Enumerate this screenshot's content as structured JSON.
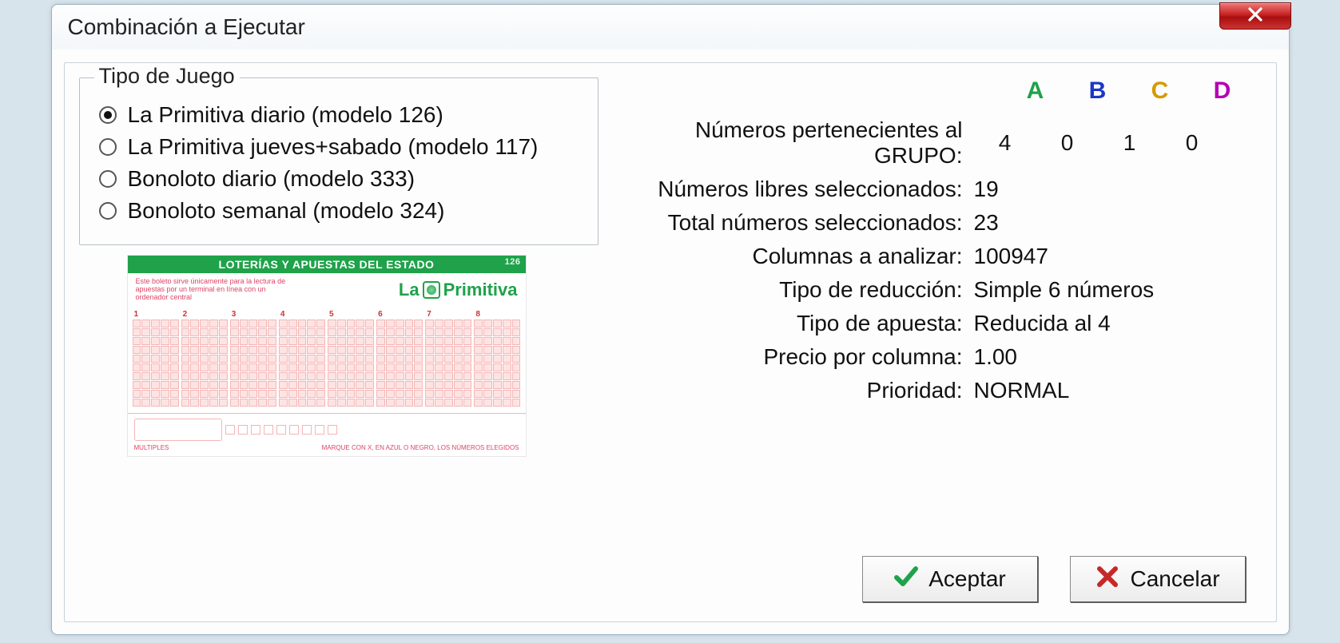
{
  "window": {
    "title": "Combinación a Ejecutar"
  },
  "gameType": {
    "legend": "Tipo de Juego",
    "options": [
      "La Primitiva diario (modelo 126)",
      "La Primitiva jueves+sabado (modelo 117)",
      "Bonoloto diario (modelo 333)",
      "Bonoloto semanal (modelo 324)"
    ],
    "selectedIndex": 0
  },
  "ticket": {
    "header": "LOTERÍAS Y APUESTAS DEL ESTADO",
    "model": "126",
    "brand_left": "La",
    "brand_right": "Primitiva",
    "footer_left": "MULTIPLES",
    "footer_right": "MARQUE CON X, EN AZUL O NEGRO, LOS NÚMEROS ELEGIDOS"
  },
  "groups": {
    "label": "Números pertenecientes al GRUPO:",
    "letters": [
      "A",
      "B",
      "C",
      "D"
    ],
    "values": [
      "4",
      "0",
      "1",
      "0"
    ]
  },
  "stats": {
    "free_label": "Números libres seleccionados:",
    "free_value": "19",
    "total_label": "Total números seleccionados:",
    "total_value": "23",
    "columns_label": "Columnas a analizar:",
    "columns_value": "100947",
    "reduction_label": "Tipo de reducción:",
    "reduction_value": "Simple 6 números",
    "bet_label": "Tipo de apuesta:",
    "bet_value": "Reducida al 4",
    "price_label": "Precio por columna:",
    "price_value": "1.00",
    "priority_label": "Prioridad:",
    "priority_value": "NORMAL"
  },
  "buttons": {
    "accept": "Aceptar",
    "cancel": "Cancelar"
  }
}
